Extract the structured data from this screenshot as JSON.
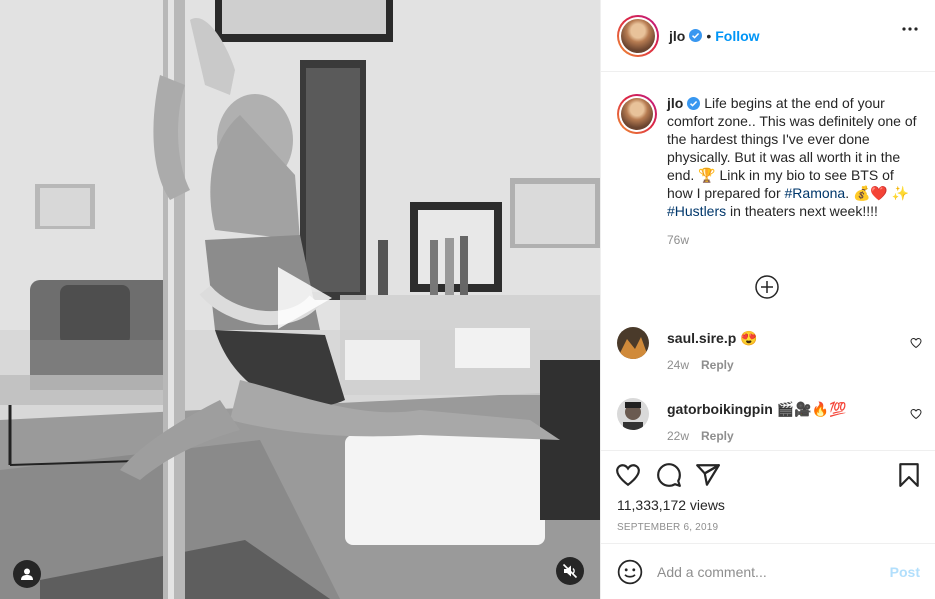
{
  "media": {
    "play_icon": "play-icon",
    "tag_icon": "user-tag-icon",
    "mute_icon": "muted-speaker-icon"
  },
  "header": {
    "username": "jlo",
    "separator": "•",
    "follow_label": "Follow",
    "more_icon": "more-options-icon"
  },
  "caption": {
    "username": "jlo",
    "part1": " Life begins at the end of your comfort zone.. This was definitely one of the hardest things I've ever done physically. But it was all worth it in the end. 🏆 Link in my bio to see BTS of how I prepared for ",
    "hashtag1": "#Ramona",
    "part2": ". 💰❤️ ✨ ",
    "hashtag2": "#Hustlers",
    "part3": " in theaters next week!!!!",
    "age": "76w"
  },
  "comments": [
    {
      "username": "saul.sire.p",
      "text": " 😍",
      "age": "24w",
      "reply_label": "Reply"
    },
    {
      "username": "gatorboikingpin",
      "text": " 🎬🎥🔥💯",
      "age": "22w",
      "reply_label": "Reply"
    }
  ],
  "actions": {
    "like_icon": "heart-icon",
    "comment_icon": "comment-icon",
    "share_icon": "share-icon",
    "save_icon": "bookmark-icon",
    "views": "11,333,172 views",
    "date": "SEPTEMBER 6, 2019"
  },
  "add_comment": {
    "emoji_icon": "emoji-icon",
    "placeholder": "Add a comment...",
    "post_label": "Post"
  },
  "colors": {
    "link_blue": "#0095f6",
    "hashtag": "#00376b",
    "muted": "#8e8e8e",
    "post_disabled": "#b2dffc"
  }
}
